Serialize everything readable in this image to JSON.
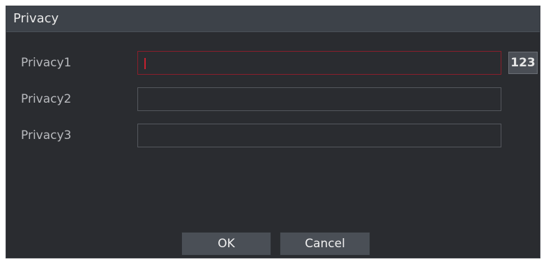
{
  "dialog": {
    "title": "Privacy"
  },
  "fields": [
    {
      "label": "Privacy1",
      "value": "",
      "focused": true
    },
    {
      "label": "Privacy2",
      "value": ""
    },
    {
      "label": "Privacy3",
      "value": ""
    }
  ],
  "keyboard_toggle_label": "123",
  "buttons": {
    "ok_label": "OK",
    "cancel_label": "Cancel"
  },
  "colors": {
    "background": "#2a2c30",
    "titlebar": "#3d4249",
    "focus_border": "#8a1f2b",
    "caret": "#c8202f",
    "button": "#4a4f56"
  }
}
